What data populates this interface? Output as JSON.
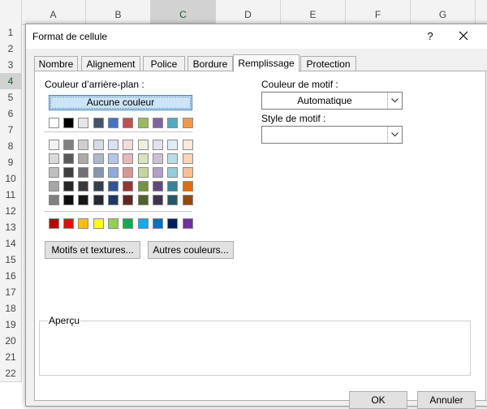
{
  "sheet": {
    "columns": [
      "A",
      "B",
      "C",
      "D",
      "E",
      "F",
      "G"
    ],
    "selected_column": "C",
    "rows": [
      "1",
      "2",
      "3",
      "4",
      "5",
      "6",
      "7",
      "8",
      "9",
      "10",
      "11",
      "12",
      "13",
      "14",
      "15",
      "16",
      "17",
      "18",
      "19",
      "20",
      "21",
      "22"
    ],
    "selected_row": "4"
  },
  "dialog": {
    "title": "Format de cellule",
    "help_label": "?",
    "tabs": [
      "Nombre",
      "Alignement",
      "Police",
      "Bordure",
      "Remplissage",
      "Protection"
    ],
    "active_tab": "Remplissage",
    "bg_color_label": "Couleur d’arrière-plan :",
    "no_color_label": "Aucune couleur",
    "pattern_color_label": "Couleur de motif :",
    "pattern_color_value": "Automatique",
    "pattern_style_label": "Style de motif :",
    "pattern_style_value": "",
    "fill_effects_button": "Motifs et textures...",
    "more_colors_button": "Autres couleurs...",
    "preview_label": "Aperçu",
    "ok_button": "OK",
    "cancel_button": "Annuler"
  },
  "palette": {
    "theme_top": [
      "#ffffff",
      "#000000",
      "#e7e6e6",
      "#44546a",
      "#4472c4",
      "#c0504d",
      "#9bbb59",
      "#8064a2",
      "#4bacc6",
      "#f79646"
    ],
    "theme_shades": [
      [
        "#f2f2f2",
        "#808080",
        "#d0cece",
        "#d6dce4",
        "#d9e1f2",
        "#f2dcdb",
        "#ebf1de",
        "#e4dfec",
        "#daeef3",
        "#fde9d9"
      ],
      [
        "#d9d9d9",
        "#595959",
        "#aeaaaa",
        "#acb9ca",
        "#b4c6e7",
        "#e6b8b7",
        "#d8e4bc",
        "#ccc0da",
        "#b7dee8",
        "#fcd5b4"
      ],
      [
        "#bfbfbf",
        "#404040",
        "#757171",
        "#8497b0",
        "#8eaadb",
        "#da9694",
        "#c4d79b",
        "#b1a0c7",
        "#92cddc",
        "#fabf8f"
      ],
      [
        "#a6a6a6",
        "#262626",
        "#3a3838",
        "#333f4f",
        "#2f5597",
        "#963634",
        "#76933c",
        "#60497a",
        "#31869b",
        "#e26b0a"
      ],
      [
        "#808080",
        "#0d0d0d",
        "#161616",
        "#222a35",
        "#1f3864",
        "#632523",
        "#4f6228",
        "#403151",
        "#215967",
        "#974706"
      ]
    ],
    "standard": [
      "#c00000",
      "#ff0000",
      "#ffc000",
      "#ffff00",
      "#92d050",
      "#00b050",
      "#00b0f0",
      "#0070c0",
      "#002060",
      "#7030a0"
    ]
  }
}
